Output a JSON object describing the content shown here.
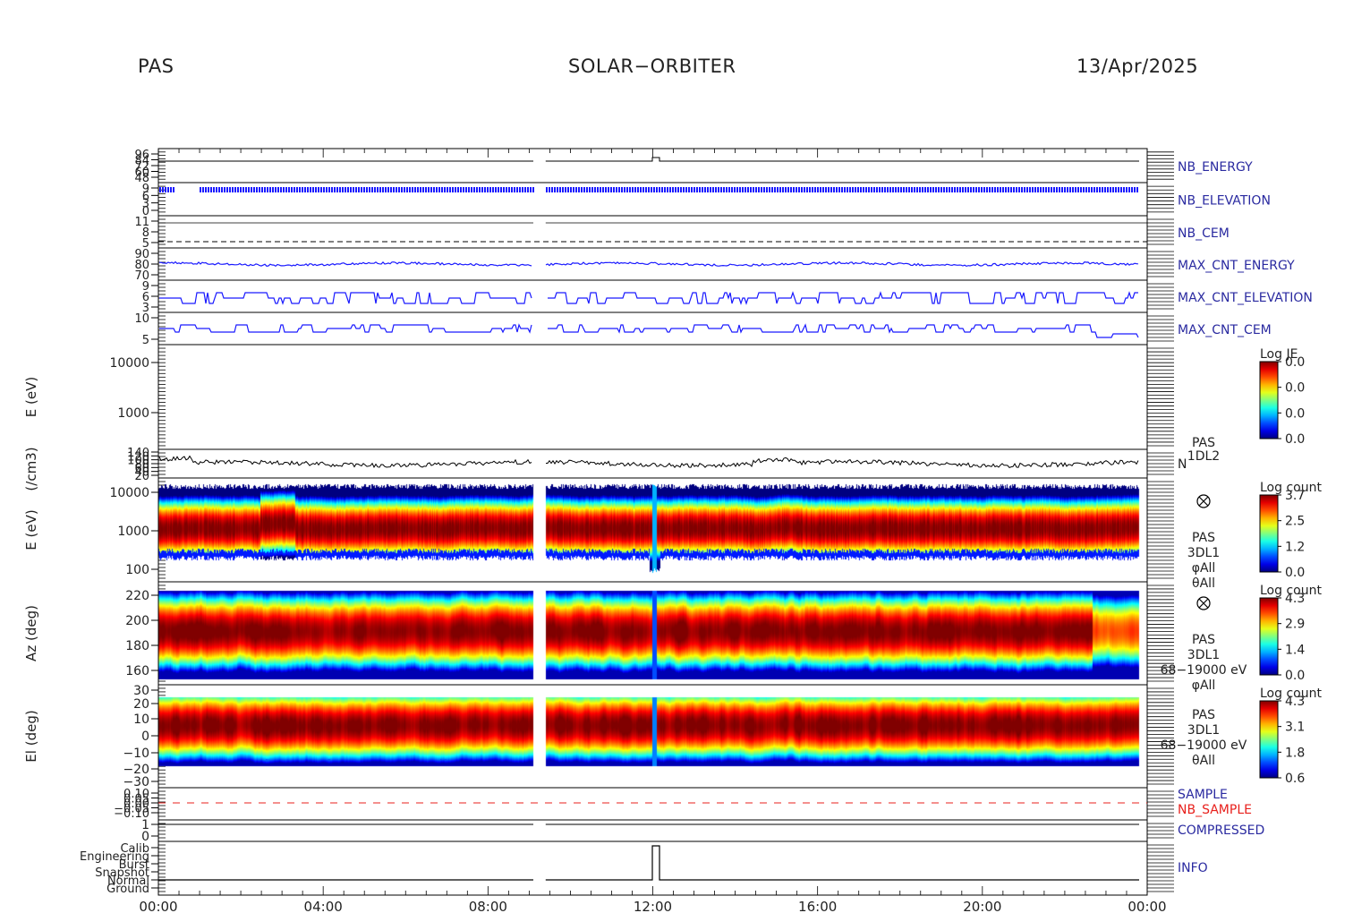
{
  "header": {
    "instrument": "PAS",
    "mission": "SOLAR−ORBITER",
    "date": "13/Apr/2025"
  },
  "colors": {
    "blue_trace": "#1a1aff",
    "red_label": "#e8201c",
    "label_blue": "#2a2aa0"
  },
  "chart_data": {
    "type": "heatmap",
    "x_axis": {
      "ticks": [
        "00:00",
        "04:00",
        "08:00",
        "12:00",
        "16:00",
        "20:00",
        "00:00"
      ],
      "range_hours": [
        0,
        24
      ]
    },
    "data_gap_hours": [
      9.1,
      9.4
    ],
    "panels": [
      {
        "id": "nb_energy",
        "type": "line",
        "right_label": "NB_ENERGY",
        "right_color": "#2a2aa0",
        "tick_labels": [
          "96",
          "84",
          "72",
          "60",
          "48"
        ],
        "ylim": [
          48,
          96
        ]
      },
      {
        "id": "nb_elevation",
        "type": "line",
        "right_label": "NB_ELEVATION",
        "right_color": "#2a2aa0",
        "tick_labels": [
          "9",
          "6",
          "3",
          "0"
        ],
        "ylim": [
          0,
          9
        ]
      },
      {
        "id": "nb_cem",
        "type": "line",
        "right_label": "NB_CEM",
        "right_color": "#2a2aa0",
        "tick_labels": [
          "11",
          "8",
          "5"
        ],
        "ylim": [
          5,
          11
        ]
      },
      {
        "id": "max_cnt_energy",
        "type": "line",
        "right_label": "MAX_CNT_ENERGY",
        "right_color": "#2a2aa0",
        "tick_labels": [
          "90",
          "80",
          "70"
        ],
        "ylim": [
          70,
          90
        ]
      },
      {
        "id": "max_cnt_elevation",
        "type": "line",
        "right_label": "MAX_CNT_ELEVATION",
        "right_color": "#2a2aa0",
        "tick_labels": [
          "9",
          "6",
          "3"
        ],
        "ylim": [
          3,
          9
        ]
      },
      {
        "id": "max_cnt_cem",
        "type": "line",
        "right_label": "MAX_CNT_CEM",
        "right_color": "#2a2aa0",
        "tick_labels": [
          "10",
          "5"
        ],
        "ylim": [
          5,
          10
        ]
      },
      {
        "id": "energy_empty",
        "type": "spectrogram",
        "ylabel": "E (eV)",
        "yscale": "log",
        "tick_labels": [
          "10000",
          "1000"
        ],
        "colorbar": {
          "title": "Log JE",
          "ticks": [
            "0.0",
            "0.0",
            "0.0",
            "0.0"
          ]
        }
      },
      {
        "id": "density",
        "type": "line",
        "ylabel": "(/cm3)",
        "tick_labels": [
          "140",
          "120",
          "100",
          "80",
          "60",
          "40",
          "20"
        ],
        "ylim": [
          20,
          140
        ],
        "right_lines": [
          "PAS",
          "1DL2"
        ],
        "series_label": "N"
      },
      {
        "id": "energy_spec",
        "type": "spectrogram",
        "ylabel": "E (eV)",
        "yscale": "log",
        "tick_labels": [
          "10000",
          "1000",
          "100"
        ],
        "colorbar": {
          "title": "Log count",
          "ticks": [
            "3.7",
            "2.5",
            "1.2",
            "0.0"
          ]
        },
        "right_lines": [
          "PAS",
          "3DL1",
          "φAll",
          "θAll"
        ]
      },
      {
        "id": "azimuth_spec",
        "type": "spectrogram",
        "ylabel": "Az (deg)",
        "tick_labels": [
          "220",
          "200",
          "180",
          "160"
        ],
        "ylim": [
          152,
          228
        ],
        "colorbar": {
          "title": "Log count",
          "ticks": [
            "4.3",
            "2.9",
            "1.4",
            "0.0"
          ]
        },
        "right_lines": [
          "PAS",
          "3DL1",
          "68−19000 eV",
          "φAll"
        ]
      },
      {
        "id": "elevation_spec",
        "type": "spectrogram",
        "ylabel": "El (deg)",
        "tick_labels": [
          "30",
          "20",
          "10",
          "0",
          "−10",
          "−20",
          "−30"
        ],
        "ylim": [
          -30,
          30
        ],
        "colorbar": {
          "title": "Log count",
          "ticks": [
            "4.3",
            "3.1",
            "1.8",
            "0.6"
          ]
        },
        "right_lines": [
          "PAS",
          "3DL1",
          "68−19000 eV",
          "θAll"
        ]
      },
      {
        "id": "sample",
        "type": "line",
        "right_label": "SAMPLE",
        "right_label_2": "NB_SAMPLE",
        "tick_labels": [
          "0.10",
          "0.05",
          "0.00",
          "−0.05",
          "−0.10"
        ],
        "ylim": [
          -0.1,
          0.1
        ]
      },
      {
        "id": "compressed",
        "type": "line",
        "right_label": "COMPRESSED",
        "tick_labels": [
          "1",
          "0"
        ],
        "ylim": [
          0,
          1
        ]
      },
      {
        "id": "info",
        "type": "line",
        "right_label": "INFO",
        "tick_labels": [
          "Calib",
          "Engineering",
          "Burst",
          "Snapshot",
          "Normal",
          "Ground"
        ]
      }
    ]
  }
}
